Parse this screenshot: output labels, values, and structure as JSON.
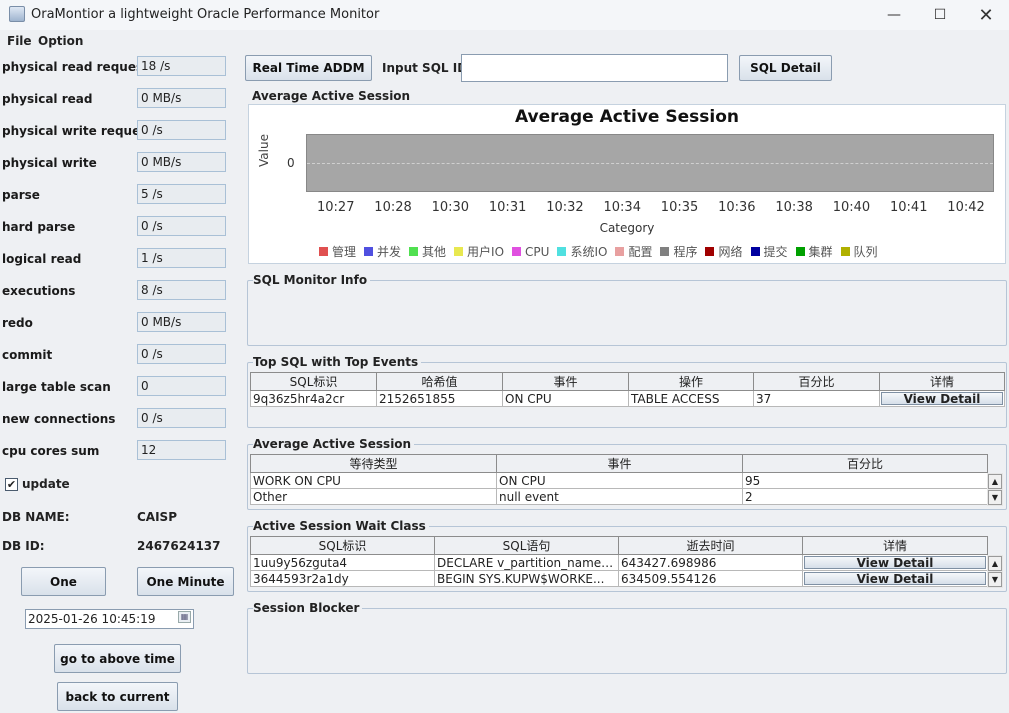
{
  "window": {
    "title": "OraMontior a lightweight Oracle Performance Monitor"
  },
  "menu": {
    "file": "File",
    "option": "Option"
  },
  "stats": [
    {
      "label": "physical read request",
      "value": "18 /s"
    },
    {
      "label": "physical read",
      "value": "0 MB/s"
    },
    {
      "label": "physical write request",
      "value": "0 /s"
    },
    {
      "label": "physical write",
      "value": "0 MB/s"
    },
    {
      "label": "parse",
      "value": "5 /s"
    },
    {
      "label": "hard parse",
      "value": "0 /s"
    },
    {
      "label": "logical read",
      "value": "1 /s"
    },
    {
      "label": "executions",
      "value": "8 /s"
    },
    {
      "label": "redo",
      "value": "0 MB/s"
    },
    {
      "label": "commit",
      "value": "0 /s"
    },
    {
      "label": "large table scan",
      "value": "0"
    },
    {
      "label": "new connections",
      "value": "0 /s"
    },
    {
      "label": "cpu cores sum",
      "value": "12"
    }
  ],
  "update": {
    "label": "update",
    "checked": true
  },
  "db": {
    "name_label": "DB NAME:",
    "name_value": "CAISP",
    "id_label": "DB ID:",
    "id_value": "2467624137"
  },
  "buttons": {
    "one": "One",
    "one_minute": "One Minute",
    "go_to_above": "go to above time",
    "back_to_current": "back to current",
    "real_time_addm": "Real Time ADDM",
    "sql_detail": "SQL Detail"
  },
  "datetime": {
    "value": "2025-01-26 10:45:19"
  },
  "sql_id": {
    "label": "Input SQL ID",
    "value": ""
  },
  "panels": {
    "aas_chart": "Average Active Session",
    "sql_monitor": "SQL Monitor Info",
    "top_sql": "Top SQL with Top Events",
    "aas_table": "Average Active Session",
    "wait_class": "Active Session Wait Class",
    "blocker": "Session Blocker"
  },
  "chart_data": {
    "type": "area",
    "title": "Average Active Session",
    "xlabel": "Category",
    "ylabel": "Value",
    "x": [
      "10:27",
      "10:28",
      "10:30",
      "10:31",
      "10:32",
      "10:34",
      "10:35",
      "10:36",
      "10:38",
      "10:40",
      "10:41",
      "10:42"
    ],
    "y_ticks": [
      "0"
    ],
    "legend": [
      {
        "name": "管理",
        "color": "#e05050"
      },
      {
        "name": "并发",
        "color": "#5050e0"
      },
      {
        "name": "其他",
        "color": "#50e050"
      },
      {
        "name": "用户IO",
        "color": "#e8e850"
      },
      {
        "name": "CPU",
        "color": "#e050e0"
      },
      {
        "name": "系统IO",
        "color": "#50e0e0"
      },
      {
        "name": "配置",
        "color": "#e8a0a0"
      },
      {
        "name": "程序",
        "color": "#808080"
      },
      {
        "name": "网络",
        "color": "#a00000"
      },
      {
        "name": "提交",
        "color": "#0000a0"
      },
      {
        "name": "集群",
        "color": "#00a000"
      },
      {
        "name": "队列",
        "color": "#b0b000"
      }
    ],
    "legend_position": "bottom",
    "plot_background": "#a6a6a6"
  },
  "top_sql": {
    "headers": [
      "SQL标识",
      "哈希值",
      "事件",
      "操作",
      "百分比",
      "详情"
    ],
    "rows": [
      {
        "sql_id": "9q36z5hr4a2cr",
        "hash": "2152651855",
        "event": "ON CPU",
        "operation": "TABLE ACCESS",
        "percent": "37",
        "detail": "View Detail"
      }
    ]
  },
  "aas_table": {
    "headers": [
      "等待类型",
      "事件",
      "百分比"
    ],
    "rows": [
      {
        "wait_type": "WORK ON CPU",
        "event": "ON CPU",
        "percent": "95"
      },
      {
        "wait_type": "Other",
        "event": "null event",
        "percent": "2"
      }
    ]
  },
  "wait_class": {
    "headers": [
      "SQL标识",
      "SQL语句",
      "逝去时间",
      "详情"
    ],
    "rows": [
      {
        "sql_id": "1uu9y56zguta4",
        "sql_text": "DECLARE   v_partition_name v...",
        "elapsed": "643427.698986",
        "detail": "View Detail"
      },
      {
        "sql_id": "3644593r2a1dy",
        "sql_text": " BEGIN    SYS.KUPW$WORKE...",
        "elapsed": "634509.554126",
        "detail": "View Detail"
      }
    ]
  }
}
